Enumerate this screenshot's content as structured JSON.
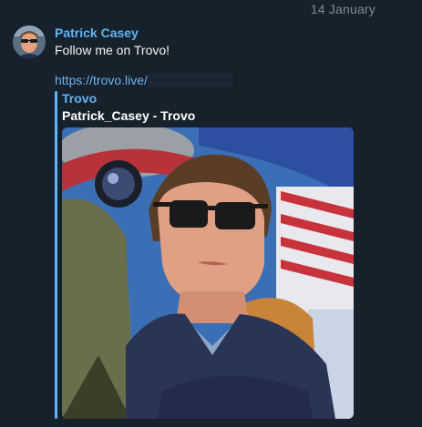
{
  "date_header": "14 January",
  "message": {
    "sender_name": "Patrick Casey",
    "text": "Follow me on Trovo!",
    "link_text": "https://trovo.live/",
    "preview": {
      "site_name": "Trovo",
      "title": "Patrick_Casey - Trovo"
    }
  },
  "colors": {
    "background": "#17212b",
    "accent": "#5eb5f7",
    "link": "#6ab3f3",
    "date": "#7f8b97",
    "text": "#f5f5f5"
  },
  "icons": {
    "avatar": "user-avatar-photo",
    "preview": "link-preview-photo"
  }
}
